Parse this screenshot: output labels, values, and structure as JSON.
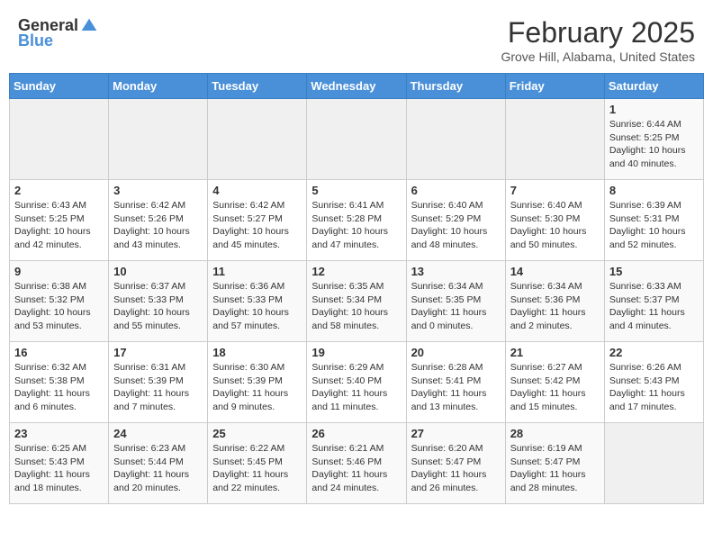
{
  "header": {
    "logo_general": "General",
    "logo_blue": "Blue",
    "month_title": "February 2025",
    "location": "Grove Hill, Alabama, United States"
  },
  "days_of_week": [
    "Sunday",
    "Monday",
    "Tuesday",
    "Wednesday",
    "Thursday",
    "Friday",
    "Saturday"
  ],
  "weeks": [
    [
      {
        "day": "",
        "info": ""
      },
      {
        "day": "",
        "info": ""
      },
      {
        "day": "",
        "info": ""
      },
      {
        "day": "",
        "info": ""
      },
      {
        "day": "",
        "info": ""
      },
      {
        "day": "",
        "info": ""
      },
      {
        "day": "1",
        "info": "Sunrise: 6:44 AM\nSunset: 5:25 PM\nDaylight: 10 hours and 40 minutes."
      }
    ],
    [
      {
        "day": "2",
        "info": "Sunrise: 6:43 AM\nSunset: 5:25 PM\nDaylight: 10 hours and 42 minutes."
      },
      {
        "day": "3",
        "info": "Sunrise: 6:42 AM\nSunset: 5:26 PM\nDaylight: 10 hours and 43 minutes."
      },
      {
        "day": "4",
        "info": "Sunrise: 6:42 AM\nSunset: 5:27 PM\nDaylight: 10 hours and 45 minutes."
      },
      {
        "day": "5",
        "info": "Sunrise: 6:41 AM\nSunset: 5:28 PM\nDaylight: 10 hours and 47 minutes."
      },
      {
        "day": "6",
        "info": "Sunrise: 6:40 AM\nSunset: 5:29 PM\nDaylight: 10 hours and 48 minutes."
      },
      {
        "day": "7",
        "info": "Sunrise: 6:40 AM\nSunset: 5:30 PM\nDaylight: 10 hours and 50 minutes."
      },
      {
        "day": "8",
        "info": "Sunrise: 6:39 AM\nSunset: 5:31 PM\nDaylight: 10 hours and 52 minutes."
      }
    ],
    [
      {
        "day": "9",
        "info": "Sunrise: 6:38 AM\nSunset: 5:32 PM\nDaylight: 10 hours and 53 minutes."
      },
      {
        "day": "10",
        "info": "Sunrise: 6:37 AM\nSunset: 5:33 PM\nDaylight: 10 hours and 55 minutes."
      },
      {
        "day": "11",
        "info": "Sunrise: 6:36 AM\nSunset: 5:33 PM\nDaylight: 10 hours and 57 minutes."
      },
      {
        "day": "12",
        "info": "Sunrise: 6:35 AM\nSunset: 5:34 PM\nDaylight: 10 hours and 58 minutes."
      },
      {
        "day": "13",
        "info": "Sunrise: 6:34 AM\nSunset: 5:35 PM\nDaylight: 11 hours and 0 minutes."
      },
      {
        "day": "14",
        "info": "Sunrise: 6:34 AM\nSunset: 5:36 PM\nDaylight: 11 hours and 2 minutes."
      },
      {
        "day": "15",
        "info": "Sunrise: 6:33 AM\nSunset: 5:37 PM\nDaylight: 11 hours and 4 minutes."
      }
    ],
    [
      {
        "day": "16",
        "info": "Sunrise: 6:32 AM\nSunset: 5:38 PM\nDaylight: 11 hours and 6 minutes."
      },
      {
        "day": "17",
        "info": "Sunrise: 6:31 AM\nSunset: 5:39 PM\nDaylight: 11 hours and 7 minutes."
      },
      {
        "day": "18",
        "info": "Sunrise: 6:30 AM\nSunset: 5:39 PM\nDaylight: 11 hours and 9 minutes."
      },
      {
        "day": "19",
        "info": "Sunrise: 6:29 AM\nSunset: 5:40 PM\nDaylight: 11 hours and 11 minutes."
      },
      {
        "day": "20",
        "info": "Sunrise: 6:28 AM\nSunset: 5:41 PM\nDaylight: 11 hours and 13 minutes."
      },
      {
        "day": "21",
        "info": "Sunrise: 6:27 AM\nSunset: 5:42 PM\nDaylight: 11 hours and 15 minutes."
      },
      {
        "day": "22",
        "info": "Sunrise: 6:26 AM\nSunset: 5:43 PM\nDaylight: 11 hours and 17 minutes."
      }
    ],
    [
      {
        "day": "23",
        "info": "Sunrise: 6:25 AM\nSunset: 5:43 PM\nDaylight: 11 hours and 18 minutes."
      },
      {
        "day": "24",
        "info": "Sunrise: 6:23 AM\nSunset: 5:44 PM\nDaylight: 11 hours and 20 minutes."
      },
      {
        "day": "25",
        "info": "Sunrise: 6:22 AM\nSunset: 5:45 PM\nDaylight: 11 hours and 22 minutes."
      },
      {
        "day": "26",
        "info": "Sunrise: 6:21 AM\nSunset: 5:46 PM\nDaylight: 11 hours and 24 minutes."
      },
      {
        "day": "27",
        "info": "Sunrise: 6:20 AM\nSunset: 5:47 PM\nDaylight: 11 hours and 26 minutes."
      },
      {
        "day": "28",
        "info": "Sunrise: 6:19 AM\nSunset: 5:47 PM\nDaylight: 11 hours and 28 minutes."
      },
      {
        "day": "",
        "info": ""
      }
    ]
  ]
}
